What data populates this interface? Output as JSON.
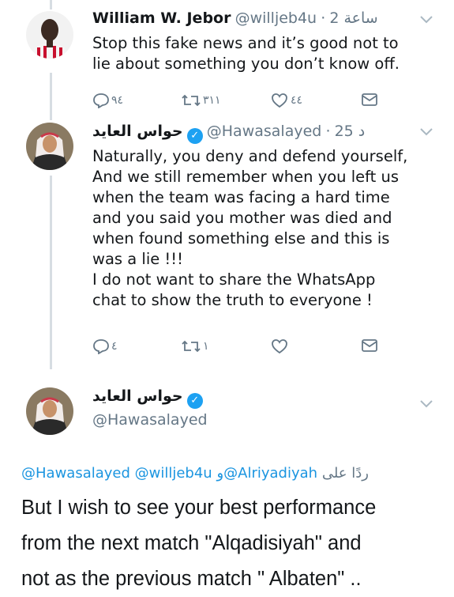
{
  "tweet1": {
    "name": "William W. Jebor",
    "handle": "@willjeb4u",
    "time": "2 ساعة",
    "text": "Stop this fake news and it’s good not to\nlie about something you don’t know off.",
    "replies": "٩٤",
    "retweets": "٣١١",
    "likes": "٤٤",
    "colors": {
      "shirt": "#c8102e",
      "stripe": "#ffffff"
    }
  },
  "tweet2": {
    "name": "حواس العايد",
    "handle": "@Hawasalayed",
    "time": "25 د",
    "text": "Naturally, you deny and defend yourself,\nAnd we still remember when you left us\nwhen the team was facing a hard time\nand you said you mother was died and\nwhen found something else and this is\nwas a lie !!!\nI do not want to share the WhatsApp\nchat to show the truth to everyone !",
    "replies": "٤",
    "retweets": "١",
    "likes": ""
  },
  "tweet3": {
    "name": "حواس العايد",
    "handle": "@Hawasalayed",
    "reply_prefix": "ردًا على",
    "reply_to": "@Hawasalayed @willjeb4u و@Alriyadiyah",
    "text": "But I wish to see your best performance\nfrom the next match \"Alqadisiyah\" and\nnot as the previous match \" Albaten\" .."
  },
  "icons": [
    "reply-icon",
    "retweet-icon",
    "like-icon",
    "dm-icon",
    "chevron-down-icon",
    "verified-icon"
  ],
  "accent": "#1da1f2"
}
